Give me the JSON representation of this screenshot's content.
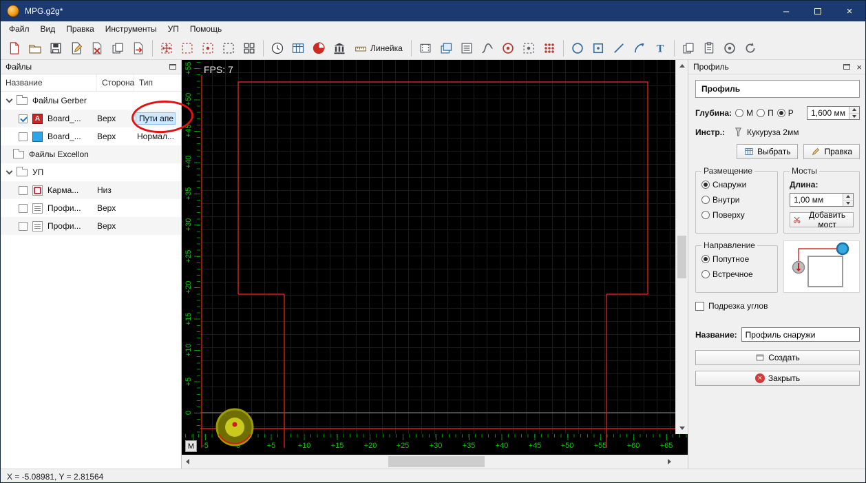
{
  "window": {
    "title": "MPG.g2g*"
  },
  "menubar": {
    "items": [
      "Файл",
      "Вид",
      "Правка",
      "Инструменты",
      "УП",
      "Помощь"
    ]
  },
  "toolbar": {
    "ruler_button": "Линейка",
    "icons": [
      "new-file",
      "open-file",
      "save-file",
      "save-as",
      "close-file",
      "copy-file",
      "import-file",
      "move-selection",
      "scale-selection",
      "zoom-selection",
      "region-selection",
      "array",
      "simulation",
      "gcode-table",
      "mill",
      "drill-columns",
      "ruler",
      "film",
      "layers",
      "aperture-list",
      "curve",
      "target",
      "region-dot",
      "matrix",
      "circle-tool",
      "rect-tool",
      "line-tool",
      "arc-tool",
      "text-tool",
      "copy",
      "paste",
      "link",
      "rotate"
    ]
  },
  "files_panel": {
    "title": "Файлы",
    "columns": {
      "name": "Название",
      "side": "Сторона",
      "type": "Тип"
    },
    "rows": [
      {
        "label": "Файлы Gerber"
      },
      {
        "name": "Board_...",
        "side": "Верх",
        "type": "Пути апе",
        "icon_letter": "A",
        "checked": true
      },
      {
        "name": "Board_...",
        "side": "Верх",
        "type": "Нормал...",
        "checked": false
      },
      {
        "label": "Файлы Excellon"
      },
      {
        "label": "УП"
      },
      {
        "name": "Карма...",
        "side": "Низ",
        "checked": false
      },
      {
        "name": "Профи...",
        "side": "Верх",
        "checked": false
      },
      {
        "name": "Профи...",
        "side": "Верх",
        "checked": false
      }
    ]
  },
  "canvas": {
    "fps": "FPS: 7",
    "mode_button": "M",
    "v_ruler": [
      "+55",
      "+50",
      "+45",
      "+40",
      "+35",
      "+30",
      "+25",
      "+20",
      "+15",
      "+10",
      "+5",
      "0"
    ],
    "h_ruler": [
      "-5",
      "0",
      "+5",
      "+10",
      "+15",
      "+20",
      "+25",
      "+30",
      "+35",
      "+40",
      "+45",
      "+50",
      "+55",
      "+60",
      "+65"
    ],
    "board_color": "#d61f1f",
    "grid_color": "#1b1b1b"
  },
  "profile_panel": {
    "dock_title": "Профиль",
    "section_title": "Профиль",
    "depth": {
      "label": "Глубина:",
      "options": [
        "М",
        "П",
        "Р"
      ],
      "selected": "Р",
      "value": "1,600 мм"
    },
    "tool": {
      "label": "Инстр.:",
      "name": "Кукуруза 2мм"
    },
    "buttons": {
      "select": "Выбрать",
      "edit": "Правка"
    },
    "placement": {
      "title": "Размещение",
      "options": [
        "Снаружи",
        "Внутри",
        "Поверху"
      ],
      "selected": "Снаружи"
    },
    "bridges": {
      "title": "Мосты",
      "length_label": "Длина:",
      "length_value": "1,00 мм",
      "add_button": "Добавить мост"
    },
    "direction": {
      "title": "Направление",
      "options": [
        "Попутное",
        "Встречное"
      ],
      "selected": "Попутное"
    },
    "corner_trim": {
      "label": "Подрезка углов",
      "checked": false
    },
    "name": {
      "label": "Название:",
      "value": "Профиль снаружи"
    },
    "create_button": "Создать",
    "close_button": "Закрыть"
  },
  "statusbar": {
    "coordinates": "X = -5.08981, Y = 2.81564"
  }
}
